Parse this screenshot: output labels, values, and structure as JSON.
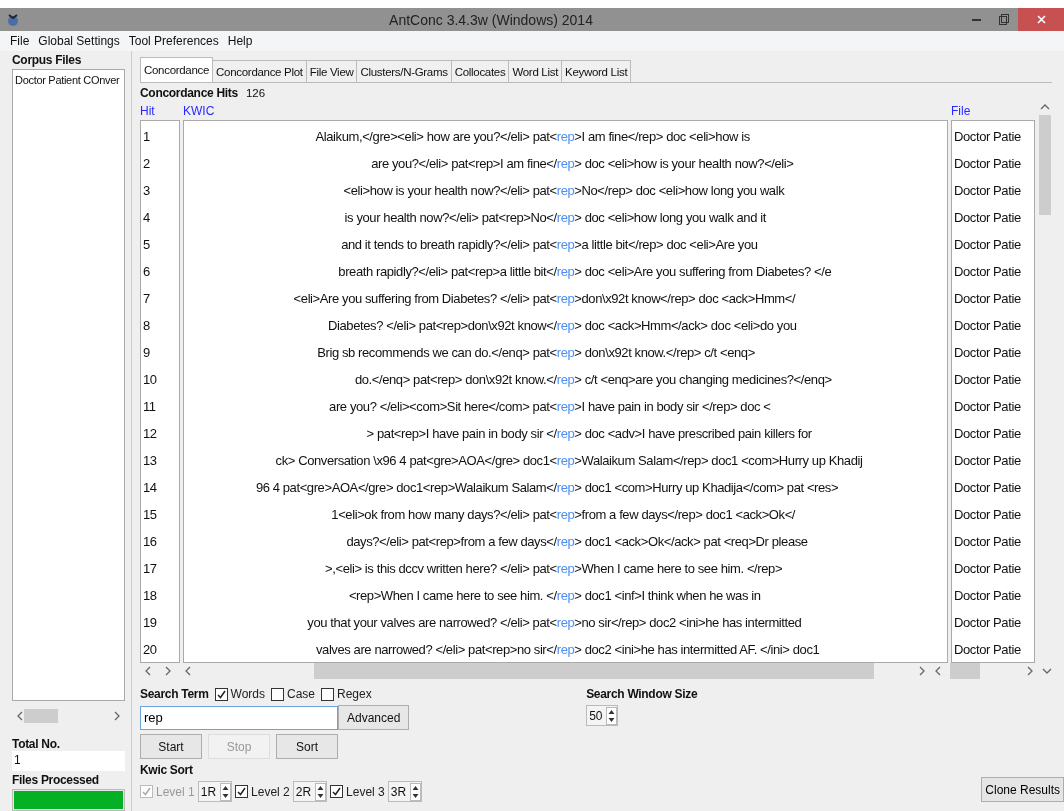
{
  "window": {
    "title": "AntConc 3.4.3w (Windows) 2014"
  },
  "menu": [
    "File",
    "Global Settings",
    "Tool Preferences",
    "Help"
  ],
  "corpus": {
    "title": "Corpus Files",
    "files": [
      "Doctor Patient COnver"
    ],
    "total_label": "Total No.",
    "total_value": "1",
    "processed_label": "Files Processed",
    "level": 1
  },
  "tabs": [
    {
      "label": "Concordance",
      "selected": true
    },
    {
      "label": "Concordance Plot",
      "selected": false
    },
    {
      "label": "File View",
      "selected": false
    },
    {
      "label": "Clusters/N-Grams",
      "selected": false
    },
    {
      "label": "Collocates",
      "selected": false
    },
    {
      "label": "Word List",
      "selected": false
    },
    {
      "label": "Keyword List",
      "selected": false
    }
  ],
  "hits": {
    "label": "Concordance Hits",
    "value": "126"
  },
  "table": {
    "columns": [
      "Hit",
      "KWIC",
      "File"
    ],
    "rows": [
      {
        "hit": "1",
        "left": "Alaikum,</gre><eli> how are you?</eli> pat<",
        "key": "rep",
        "right": ">I am fine</rep> doc <eli>how is",
        "file": "Doctor Patie"
      },
      {
        "hit": "2",
        "left": "are you?</eli> pat<rep>I am fine</",
        "key": "rep",
        "right": "> doc <eli>how is your health now?</eli>",
        "file": "Doctor Patie"
      },
      {
        "hit": "3",
        "left": "<eli>how is your health now?</eli>  pat<",
        "key": "rep",
        "right": ">No</rep> doc <eli>how long you walk",
        "file": "Doctor Patie"
      },
      {
        "hit": "4",
        "left": "is your health now?</eli>  pat<rep>No</",
        "key": "rep",
        "right": "> doc <eli>how long you walk and it",
        "file": "Doctor Patie"
      },
      {
        "hit": "5",
        "left": "and it tends to breath rapidly?</eli> pat<",
        "key": "rep",
        "right": ">a little bit</rep> doc <eli>Are you",
        "file": "Doctor Patie"
      },
      {
        "hit": "6",
        "left": "breath rapidly?</eli> pat<rep>a little bit</",
        "key": "rep",
        "right": "> doc <eli>Are you suffering from Diabetes? </e",
        "file": "Doctor Patie"
      },
      {
        "hit": "7",
        "left": "<eli>Are you suffering from Diabetes? </eli> pat<",
        "key": "rep",
        "right": ">don\\x92t know</rep> doc <ack>Hmm</",
        "file": "Doctor Patie"
      },
      {
        "hit": "8",
        "left": "Diabetes? </eli> pat<rep>don\\x92t know</",
        "key": "rep",
        "right": "> doc <ack>Hmm</ack> doc <eli>do you",
        "file": "Doctor Patie"
      },
      {
        "hit": "9",
        "left": "Brig sb recommends we can do.</enq> pat<",
        "key": "rep",
        "right": "> don\\x92t know.</rep> c/t <enq>",
        "file": "Doctor Patie"
      },
      {
        "hit": "10",
        "left": "do.</enq> pat<rep> don\\x92t know.</",
        "key": "rep",
        "right": "> c/t <enq>are you changing medicines?</enq>",
        "file": "Doctor Patie"
      },
      {
        "hit": "11",
        "left": "are you? </eli><com>Sit here</com> pat<",
        "key": "rep",
        "right": ">I have pain in body sir </rep> doc <",
        "file": "Doctor Patie"
      },
      {
        "hit": "12",
        "left": "> pat<rep>I have pain in body sir </",
        "key": "rep",
        "right": "> doc <adv>I have prescribed pain killers for",
        "file": "Doctor Patie"
      },
      {
        "hit": "13",
        "left": "ck>  Conversation \\x96 4 pat<gre>AOA</gre> doc1<",
        "key": "rep",
        "right": ">Walaikum Salam</rep> doc1 <com>Hurry up Khadij",
        "file": "Doctor Patie"
      },
      {
        "hit": "14",
        "left": "96 4 pat<gre>AOA</gre> doc1<rep>Walaikum Salam</",
        "key": "rep",
        "right": "> doc1 <com>Hurry up Khadija</com> pat <res>",
        "file": "Doctor Patie"
      },
      {
        "hit": "15",
        "left": "1<eli>ok from how many days?</eli> pat<",
        "key": "rep",
        "right": ">from a few days</rep> doc1 <ack>Ok</",
        "file": "Doctor Patie"
      },
      {
        "hit": "16",
        "left": "days?</eli> pat<rep>from a few days</",
        "key": "rep",
        "right": "> doc1 <ack>Ok</ack> pat <req>Dr please",
        "file": "Doctor Patie"
      },
      {
        "hit": "17",
        "left": ">,<eli> is this dccv written here? </eli> pat<",
        "key": "rep",
        "right": ">When I came here to see him. </rep>",
        "file": "Doctor Patie"
      },
      {
        "hit": "18",
        "left": "<rep>When I came here to see him. </",
        "key": "rep",
        "right": "> doc1 <inf>I think when he was in",
        "file": "Doctor Patie"
      },
      {
        "hit": "19",
        "left": "you that your valves are narrowed? </eli> pat<",
        "key": "rep",
        "right": ">no sir</rep> doc2 <ini>he has intermitted",
        "file": "Doctor Patie"
      },
      {
        "hit": "20",
        "left": "valves are narrowed? </eli> pat<rep>no sir</",
        "key": "rep",
        "right": "> doc2 <ini>he has intermitted AF. </ini> doc1",
        "file": "Doctor Patie"
      }
    ]
  },
  "search": {
    "label": "Search Term",
    "options": [
      {
        "label": "Words",
        "checked": true
      },
      {
        "label": "Case",
        "checked": false
      },
      {
        "label": "Regex",
        "checked": false
      }
    ],
    "value": "rep",
    "advanced": "Advanced",
    "window_size_label": "Search Window Size",
    "window_size": "50"
  },
  "buttons": [
    {
      "label": "Start",
      "disabled": false
    },
    {
      "label": "Stop",
      "disabled": true
    },
    {
      "label": "Sort",
      "disabled": false
    }
  ],
  "kwic_sort": {
    "label": "Kwic Sort",
    "levels": [
      {
        "label": "Level 1",
        "checked": true,
        "disabled": true,
        "value": "1R"
      },
      {
        "label": "Level 2",
        "checked": true,
        "disabled": false,
        "value": "2R"
      },
      {
        "label": "Level 3",
        "checked": true,
        "disabled": false,
        "value": "3R"
      }
    ]
  },
  "clone": "Clone Results"
}
